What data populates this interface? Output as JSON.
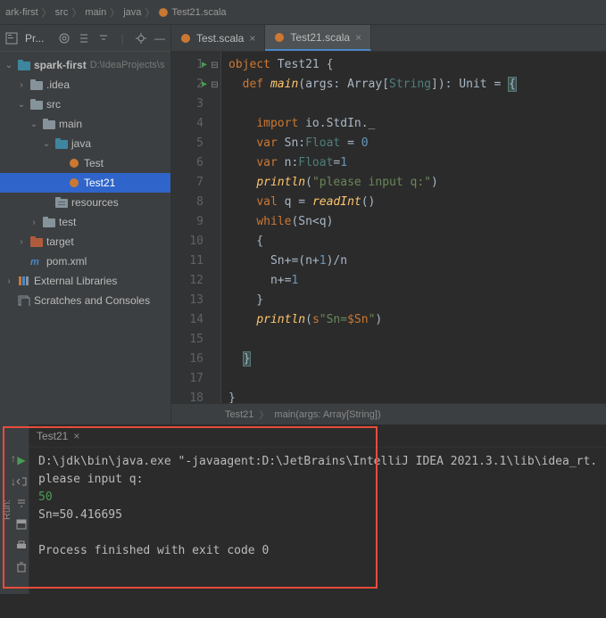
{
  "breadcrumb": {
    "items": [
      "ark-first",
      "src",
      "main",
      "java"
    ],
    "file": "Test21.scala"
  },
  "sidebar": {
    "toolbar_label": "Pr...",
    "tree": {
      "root": {
        "name": "spark-first",
        "path": "D:\\IdeaProjects\\s"
      },
      "idea": ".idea",
      "src": "src",
      "main": "main",
      "java": "java",
      "test_file": "Test",
      "test21_file": "Test21",
      "resources": "resources",
      "test": "test",
      "target": "target",
      "pom": "pom.xml",
      "external": "External Libraries",
      "scratches": "Scratches and Consoles"
    }
  },
  "tabs": {
    "tab1": "Test.scala",
    "tab2": "Test21.scala"
  },
  "editor": {
    "line_numbers": [
      "1",
      "2",
      "3",
      "4",
      "5",
      "6",
      "7",
      "8",
      "9",
      "10",
      "11",
      "12",
      "13",
      "14",
      "15",
      "16",
      "17",
      "18"
    ],
    "code": {
      "l1_kw": "object",
      "l1_name": " Test21 ",
      "l2_kw": "def",
      "l2_fn": " main",
      "l2_args": "(args: Array[",
      "l2_type": "String",
      "l2_end": "])",
      "l2_ret": ": Unit = ",
      "l4_kw": "import",
      "l4_pkg": " io.StdIn._",
      "l5_kw": "var",
      "l5_name": " Sn:",
      "l5_type": "Float",
      "l5_eq": " = ",
      "l5_num": "0",
      "l6_kw": "var",
      "l6_name": " n:",
      "l6_type": "Float",
      "l6_eq": "=",
      "l6_num": "1",
      "l7_fn": "println",
      "l7_str": "\"please input q:\"",
      "l8_kw": "val",
      "l8_name": " q = ",
      "l8_fn": "readInt",
      "l8_paren": "()",
      "l9_kw": "while",
      "l9_cond": "(Sn<q)",
      "l11_body": "Sn+=(n+",
      "l11_num": "1",
      "l11_end": ")/n",
      "l12_body": "n+=",
      "l12_num": "1",
      "l14_fn": "println",
      "l14_pre": "(",
      "l14_s": "s",
      "l14_str": "\"Sn=",
      "l14_interp": "$Sn",
      "l14_end": "\"",
      "l14_close": ")"
    }
  },
  "structure": {
    "cls": "Test21",
    "method": "main(args: Array[String])"
  },
  "run": {
    "label": "Run:",
    "tab": "Test21",
    "console": {
      "cmd": "D:\\jdk\\bin\\java.exe \"-javaagent:D:\\JetBrains\\IntelliJ IDEA 2021.3.1\\lib\\idea_rt.",
      "prompt": "please input q:",
      "input": "50",
      "output": "Sn=50.416695",
      "exit": "Process finished with exit code 0"
    }
  }
}
